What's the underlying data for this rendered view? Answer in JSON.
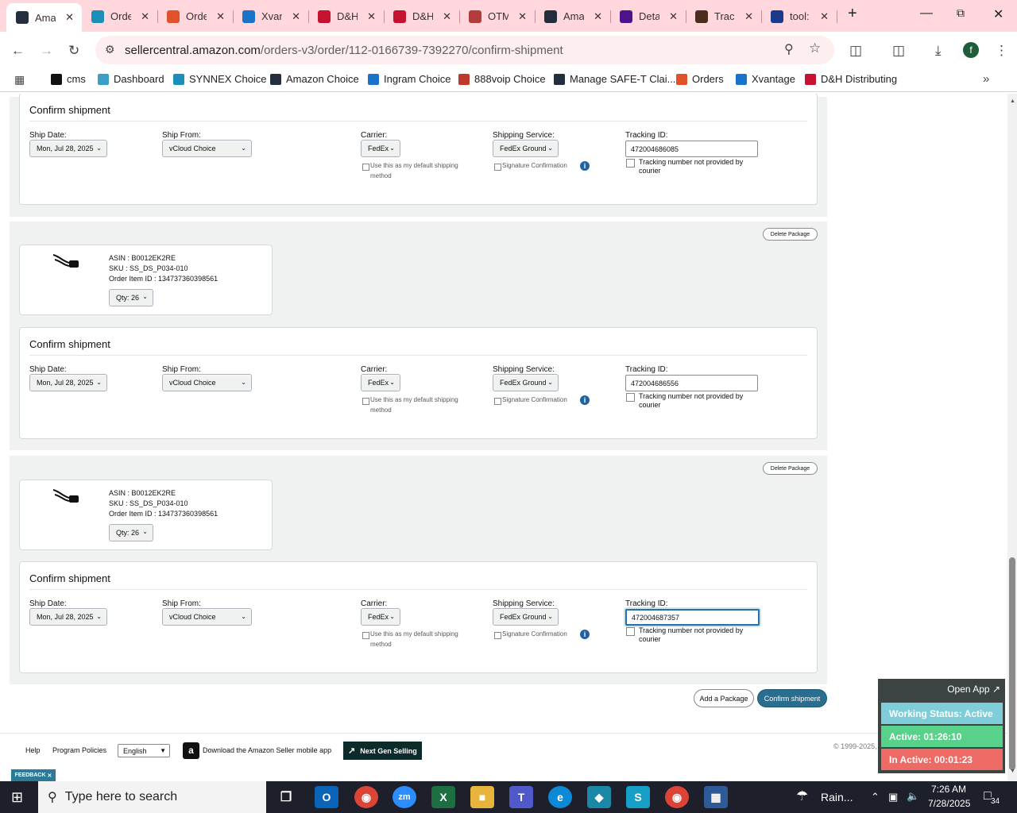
{
  "browser": {
    "tabs": [
      {
        "title": "Ama",
        "icon": "amazon-icon",
        "color": "#232f3e"
      },
      {
        "title": "Orde",
        "icon": "ec-icon",
        "color": "#1b8fb9"
      },
      {
        "title": "Orde",
        "icon": "orders-icon",
        "color": "#e0522a"
      },
      {
        "title": "Xvan",
        "icon": "xvantage-icon",
        "color": "#1a73c8"
      },
      {
        "title": "D&H",
        "icon": "dh-icon",
        "color": "#c4122f"
      },
      {
        "title": "D&H",
        "icon": "dh-icon",
        "color": "#c4122f"
      },
      {
        "title": "OTM",
        "icon": "otm-icon",
        "color": "#b23b3b"
      },
      {
        "title": "Ama",
        "icon": "amazon-icon",
        "color": "#232f3e"
      },
      {
        "title": "Deta",
        "icon": "fedex-icon",
        "color": "#4d148c"
      },
      {
        "title": "Tracl",
        "icon": "ups-icon",
        "color": "#4b2e1e"
      },
      {
        "title": "tool:",
        "icon": "tool-icon",
        "color": "#1b3a8a"
      }
    ],
    "url_host": "sellercentral.amazon.com",
    "url_path": "/orders-v3/order/112-0166739-7392270/confirm-shipment",
    "bookmarks": [
      {
        "label": "cms",
        "color": "#111"
      },
      {
        "label": "Dashboard",
        "color": "#3aa0c8"
      },
      {
        "label": "SYNNEX Choice",
        "color": "#1b8fb9"
      },
      {
        "label": "Amazon Choice",
        "color": "#232f3e"
      },
      {
        "label": "Ingram Choice",
        "color": "#1a73c8"
      },
      {
        "label": "888voip Choice",
        "color": "#c0392b"
      },
      {
        "label": "Manage SAFE-T Clai...",
        "color": "#232f3e"
      },
      {
        "label": "Orders",
        "color": "#e0522a"
      },
      {
        "label": "Xvantage",
        "color": "#1a73c8"
      },
      {
        "label": "D&H Distributing",
        "color": "#c4122f"
      }
    ],
    "profile_initial": "f"
  },
  "labels": {
    "confirm_shipment": "Confirm shipment",
    "ship_date": "Ship Date:",
    "ship_from": "Ship From:",
    "carrier": "Carrier:",
    "shipping_service": "Shipping Service:",
    "tracking_id": "Tracking ID:",
    "default_method_1": "Use this as my default shipping",
    "default_method_2": "method",
    "signature": "Signature Confirmation",
    "not_provided_1": "Tracking number not provided by",
    "not_provided_2": "courier",
    "delete_package": "Delete Package"
  },
  "shipments": [
    {
      "ship_date": "Mon, Jul 28, 2025",
      "ship_from": "vCloud Choice",
      "carrier": "FedEx",
      "service": "FedEx Ground",
      "tracking": "472004686085"
    },
    {
      "ship_date": "Mon, Jul 28, 2025",
      "ship_from": "vCloud Choice",
      "carrier": "FedEx",
      "service": "FedEx Ground",
      "tracking": "472004686556"
    },
    {
      "ship_date": "Mon, Jul 28, 2025",
      "ship_from": "vCloud Choice",
      "carrier": "FedEx",
      "service": "FedEx Ground",
      "tracking": "472004687357"
    }
  ],
  "items": [
    {
      "asin": "ASIN : B0012EK2RE",
      "sku": "SKU : SS_DS_P034-010",
      "order_item": "Order Item ID : 134737360398561",
      "qty": "Qty: 26"
    },
    {
      "asin": "ASIN : B0012EK2RE",
      "sku": "SKU : SS_DS_P034-010",
      "order_item": "Order Item ID : 134737360398561",
      "qty": "Qty: 26"
    }
  ],
  "actions": {
    "add_package": "Add a Package",
    "confirm_shipment": "Confirm shipment"
  },
  "footer": {
    "help": "Help",
    "program_policies": "Program Policies",
    "language": "English",
    "download_app": "Download the Amazon Seller mobile app",
    "next_gen": "Next Gen Selling",
    "copyright": "© 1999-2025,",
    "feedback": "FEEDBACK"
  },
  "widget": {
    "open_app": "Open App",
    "working_status": "Working Status: Active",
    "active": "Active: 01:26:10",
    "inactive": "In Active: 00:01:23",
    "colors": {
      "status": "#7fcdd8",
      "active": "#58d18a",
      "inactive": "#ee6a64"
    }
  },
  "taskbar": {
    "search_placeholder": "Type here to search",
    "weather": "Rain...",
    "time": "7:26 AM",
    "date": "7/28/2025",
    "notifications": "34"
  }
}
